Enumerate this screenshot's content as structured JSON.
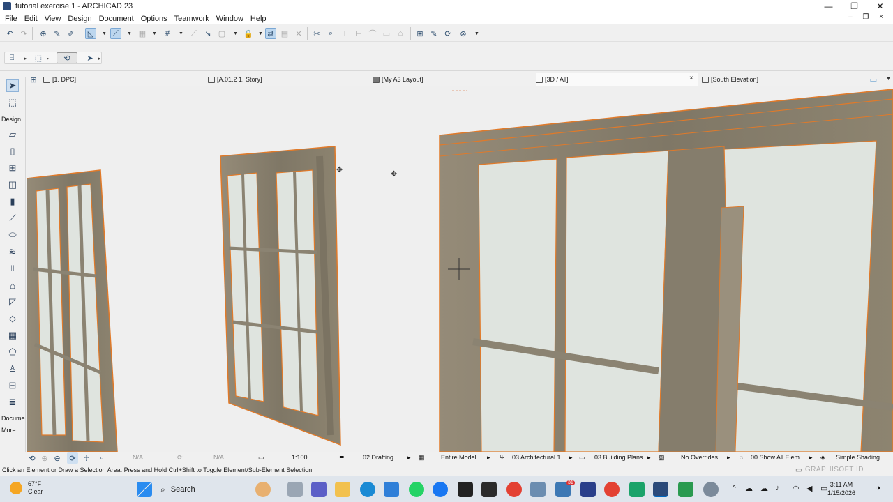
{
  "window": {
    "title": "tutorial exercise 1 - ARCHICAD 23",
    "minimize": "—",
    "maximize": "❐",
    "close": "✕"
  },
  "menu": [
    "File",
    "Edit",
    "View",
    "Design",
    "Document",
    "Options",
    "Teamwork",
    "Window",
    "Help"
  ],
  "menu_right": "– ❐ ×",
  "tabs": [
    {
      "label": "[1. DPC]",
      "active": false
    },
    {
      "label": "[A.01.2 1. Story]",
      "active": false
    },
    {
      "label": "[My A3 Layout]",
      "active": false
    },
    {
      "label": "[3D / All]",
      "active": true
    },
    {
      "label": "[South Elevation]",
      "active": false
    }
  ],
  "tab_close": "×",
  "toolbox": {
    "design_label": "Design",
    "document_label": "Docume",
    "more_label": "More"
  },
  "viewstrip": {
    "na1": "N/A",
    "na2": "N/A",
    "scale": "1:100",
    "layer_combo": "02 Drafting",
    "model_view": "Entire Model",
    "pen_set": "03 Architectural 1...",
    "dimension": "03 Building Plans",
    "overrides": "No Overrides",
    "renovation": "00 Show All Elem...",
    "shading": "Simple Shading"
  },
  "status": {
    "message": "Click an Element or Draw a Selection Area. Press and Hold Ctrl+Shift to Toggle Element/Sub-Element Selection.",
    "brand": "GRAPHISOFT ID"
  },
  "taskbar": {
    "temp": "67°F",
    "condition": "Clear",
    "search": "Search",
    "time": "3:11 AM",
    "date": "1/15/2026",
    "badge": "31"
  },
  "colors": {
    "wood": "#8b8372",
    "outline": "#e07a2a",
    "glass": "#dde4df",
    "accent": "#0067c0"
  }
}
